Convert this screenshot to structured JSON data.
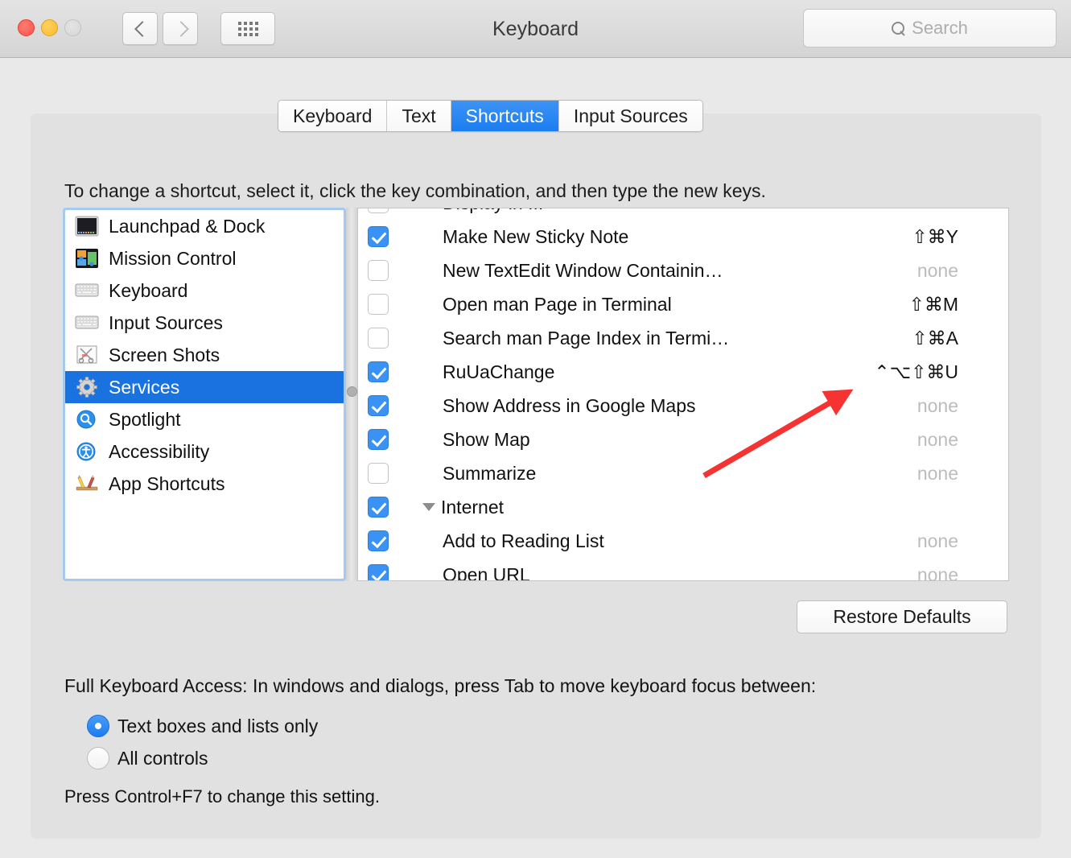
{
  "window": {
    "title": "Keyboard",
    "traffic_lights": [
      "close-button",
      "minimize-button",
      "zoom-button"
    ],
    "back_label": "Back",
    "forward_label": "Forward",
    "grid_label": "Show All"
  },
  "search": {
    "placeholder": "Search",
    "value": "",
    "icon": "search-icon"
  },
  "tabs": [
    {
      "label": "Keyboard",
      "active": false
    },
    {
      "label": "Text",
      "active": false
    },
    {
      "label": "Shortcuts",
      "active": true
    },
    {
      "label": "Input Sources",
      "active": false
    }
  ],
  "instruction": "To change a shortcut, select it, click the key combination, and then type the new keys.",
  "sidebar": {
    "items": [
      {
        "label": "Launchpad & Dock",
        "icon": "launchpad-dock-icon",
        "selected": false
      },
      {
        "label": "Mission Control",
        "icon": "mission-control-icon",
        "selected": false
      },
      {
        "label": "Keyboard",
        "icon": "keyboard-icon",
        "selected": false
      },
      {
        "label": "Input Sources",
        "icon": "input-sources-icon",
        "selected": false
      },
      {
        "label": "Screen Shots",
        "icon": "screen-shots-icon",
        "selected": false
      },
      {
        "label": "Services",
        "icon": "services-gear-icon",
        "selected": true
      },
      {
        "label": "Spotlight",
        "icon": "spotlight-icon",
        "selected": false
      },
      {
        "label": "Accessibility",
        "icon": "accessibility-icon",
        "selected": false
      },
      {
        "label": "App Shortcuts",
        "icon": "app-shortcuts-icon",
        "selected": false
      }
    ]
  },
  "shortcuts": {
    "rows": [
      {
        "label": "Display in ...",
        "checked": false,
        "key": "",
        "type": "child",
        "clipped": true
      },
      {
        "label": "Make New Sticky Note",
        "checked": true,
        "key": "⇧⌘Y",
        "type": "child"
      },
      {
        "label": "New TextEdit Window Containin…",
        "checked": false,
        "key": "none",
        "type": "child"
      },
      {
        "label": "Open man Page in Terminal",
        "checked": false,
        "key": "⇧⌘M",
        "type": "child"
      },
      {
        "label": "Search man Page Index in Termi…",
        "checked": false,
        "key": "⇧⌘A",
        "type": "child"
      },
      {
        "label": "RuUaChange",
        "checked": true,
        "key": "⌃⌥⇧⌘U",
        "type": "child"
      },
      {
        "label": "Show Address in Google Maps",
        "checked": true,
        "key": "none",
        "type": "child"
      },
      {
        "label": "Show Map",
        "checked": true,
        "key": "none",
        "type": "child"
      },
      {
        "label": "Summarize",
        "checked": false,
        "key": "none",
        "type": "child"
      },
      {
        "label": "Internet",
        "checked": true,
        "key": "",
        "type": "group"
      },
      {
        "label": "Add to Reading List",
        "checked": true,
        "key": "none",
        "type": "child"
      },
      {
        "label": "Open URL",
        "checked": true,
        "key": "none",
        "type": "child"
      }
    ]
  },
  "restore_defaults_label": "Restore Defaults",
  "full_keyboard_access": {
    "title": "Full Keyboard Access: In windows and dialogs, press Tab to move keyboard focus between:",
    "options": [
      {
        "label": "Text boxes and lists only",
        "selected": true
      },
      {
        "label": "All controls",
        "selected": false
      }
    ],
    "hint": "Press Control+F7 to change this setting."
  },
  "annotation": {
    "arrow_color": "#f53333"
  }
}
